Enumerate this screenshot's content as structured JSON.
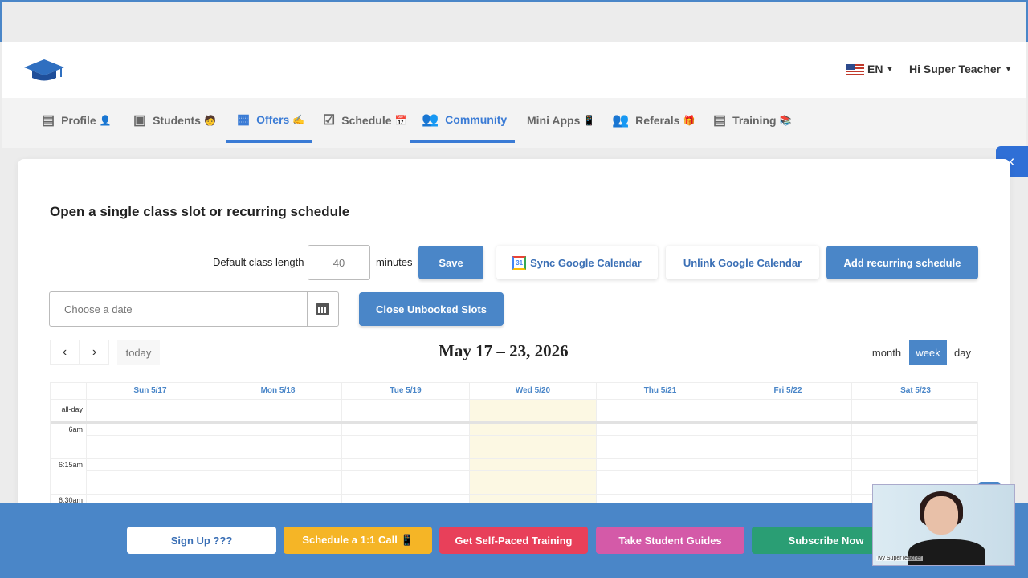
{
  "header": {
    "logo_icon": "graduation-cap-icon",
    "language": "EN",
    "user_greeting": "Hi Super Teacher"
  },
  "nav": {
    "items": [
      {
        "label": "Profile",
        "icon": "id-card-icon",
        "emoji": "👤"
      },
      {
        "label": "Students",
        "icon": "box-open-icon",
        "emoji": "🧑"
      },
      {
        "label": "Offers",
        "icon": "calendar-icon",
        "emoji": "✍"
      },
      {
        "label": "Schedule",
        "icon": "calendar-check-icon",
        "emoji": "📅"
      },
      {
        "label": "Community",
        "icon": "users-icon",
        "emoji": ""
      },
      {
        "label": "Mini Apps",
        "icon": "",
        "emoji": "📱"
      },
      {
        "label": "Referals",
        "icon": "users-icon",
        "emoji": "🎁"
      },
      {
        "label": "Training",
        "icon": "chalkboard-teacher-icon",
        "emoji": "📚"
      }
    ],
    "active": "Offers"
  },
  "form": {
    "heading": "Open a single class slot or recurring schedule",
    "length_label": "Default class length",
    "length_value": "40",
    "minutes_label": "minutes",
    "save": "Save",
    "sync_google": "Sync Google Calendar",
    "unlink_google": "Unlink Google Calendar",
    "add_recurring": "Add recurring schedule",
    "date_placeholder": "Choose a date",
    "close_unbooked": "Close Unbooked Slots"
  },
  "calendar": {
    "title": "May 17 – 23, 2026",
    "today_label": "today",
    "views": [
      "month",
      "week",
      "day"
    ],
    "active_view": "week",
    "days": [
      "Sun 5/17",
      "Mon 5/18",
      "Tue 5/19",
      "Wed 5/20",
      "Thu 5/21",
      "Fri 5/22",
      "Sat 5/23"
    ],
    "today_day": "Wed 5/20",
    "allday_label": "all-day",
    "times": [
      "6am",
      "6:15am",
      "6:30am"
    ]
  },
  "bottom_bar": {
    "buttons": [
      {
        "label": "Sign Up ???",
        "bg": "#ffffff",
        "fg": "#3a6fb5"
      },
      {
        "label": "Schedule a 1:1 Call 📱",
        "bg": "#f5b526",
        "fg": "#ffffff"
      },
      {
        "label": "Get Self-Paced Training",
        "bg": "#e8405a",
        "fg": "#ffffff"
      },
      {
        "label": "Take Student Guides",
        "bg": "#d45aa8",
        "fg": "#ffffff"
      },
      {
        "label": "Subscribe Now",
        "bg": "#2a9e74",
        "fg": "#ffffff"
      }
    ]
  },
  "video": {
    "caption": "Ivy SuperTeacher"
  },
  "colors": {
    "primary": "#4a86c8",
    "active_nav": "#3a7bd5",
    "today_highlight": "#fcf8e3"
  }
}
